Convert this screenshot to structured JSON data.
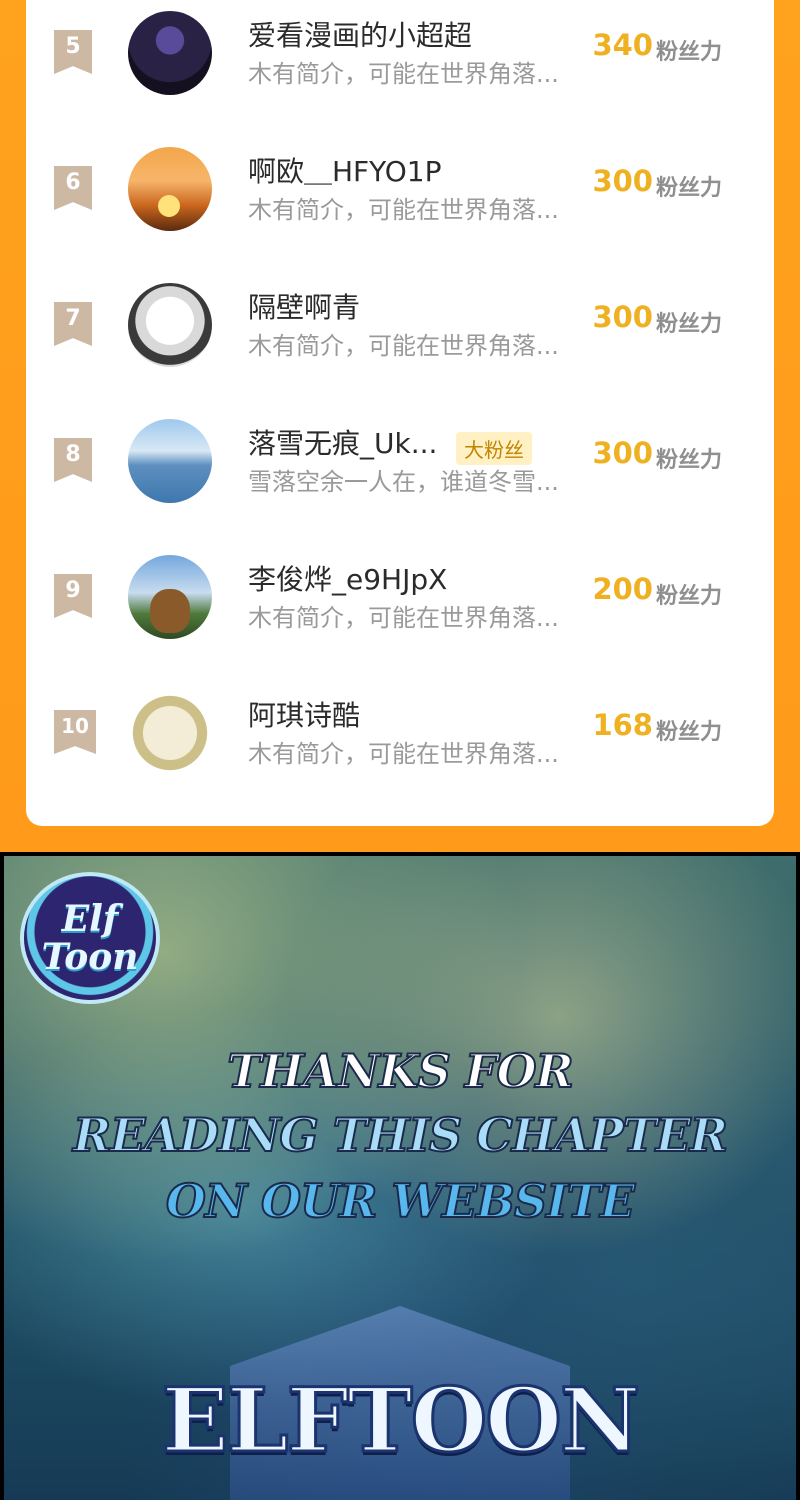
{
  "ranking": {
    "fan_label": "粉丝力",
    "rows": [
      {
        "rank": "5",
        "name": "爱看漫画的小超超",
        "badge": "",
        "bio": "木有简介，可能在世界角落...",
        "fans": "340"
      },
      {
        "rank": "6",
        "name": "啊欧＿HFYO1P",
        "badge": "",
        "bio": "木有简介，可能在世界角落...",
        "fans": "300"
      },
      {
        "rank": "7",
        "name": "隔壁啊青",
        "badge": "",
        "bio": "木有简介，可能在世界角落...",
        "fans": "300"
      },
      {
        "rank": "8",
        "name": "落雪无痕_Uk...",
        "badge": "大粉丝",
        "bio": "雪落空余一人在，谁道冬雪...",
        "fans": "300"
      },
      {
        "rank": "9",
        "name": "李俊烨_e9HJpX",
        "badge": "",
        "bio": "木有简介，可能在世界角落...",
        "fans": "200"
      },
      {
        "rank": "10",
        "name": "阿琪诗酷",
        "badge": "",
        "bio": "木有简介，可能在世界角落...",
        "fans": "168"
      }
    ]
  },
  "promo": {
    "logo_line1": "Elf",
    "logo_line2": "Toon",
    "thanks_line1": "THANKS FOR",
    "thanks_line2": "READING THIS CHAPTER",
    "thanks_line3": "ON OUR WEBSITE",
    "brand": "ELFTOON"
  }
}
